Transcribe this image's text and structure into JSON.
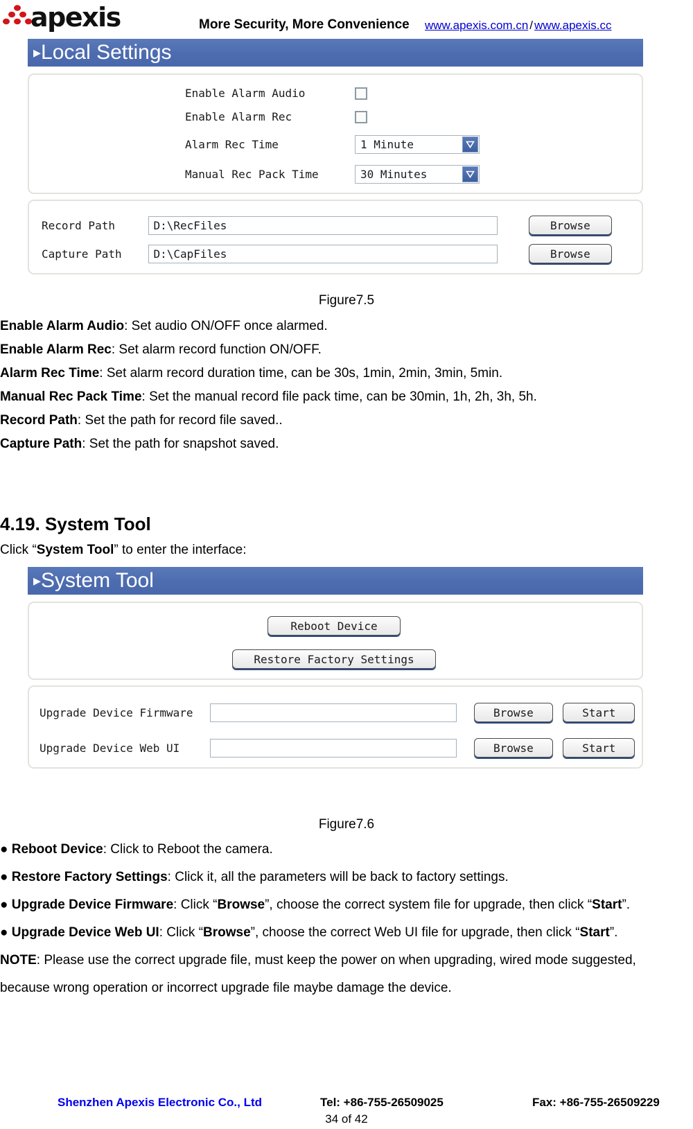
{
  "header": {
    "logo_text": "apexis",
    "tagline": "More Security, More Convenience",
    "link_primary": "www.apexis.com.cn",
    "link_separator": "/",
    "link_secondary": "www.apexis.cc"
  },
  "local_settings": {
    "titlebar": "Local Settings",
    "titlebar_arrow": "▸",
    "fields": {
      "enable_alarm_audio_label": "Enable Alarm Audio",
      "enable_alarm_audio_checked": false,
      "enable_alarm_rec_label": "Enable Alarm Rec",
      "enable_alarm_rec_checked": false,
      "alarm_rec_time_label": "Alarm Rec Time",
      "alarm_rec_time_value": "1 Minute",
      "manual_rec_pack_time_label": "Manual Rec Pack Time",
      "manual_rec_pack_time_value": "30 Minutes",
      "record_path_label": "Record Path",
      "record_path_value": "D:\\RecFiles",
      "capture_path_label": "Capture Path",
      "capture_path_value": "D:\\CapFiles",
      "browse_record_label": "Browse",
      "browse_capture_label": "Browse"
    },
    "caption": "Figure7.5"
  },
  "local_settings_desc": [
    {
      "term": "Enable Alarm Audio",
      "text": ": Set audio ON/OFF once alarmed."
    },
    {
      "term": "Enable Alarm Rec",
      "text": ": Set alarm record function ON/OFF."
    },
    {
      "term": "Alarm Rec Time",
      "text": ": Set alarm record duration time, can be 30s, 1min, 2min, 3min, 5min."
    },
    {
      "term": "Manual Rec Pack Time",
      "text": ": Set the manual record file pack time, can be 30min, 1h, 2h, 3h, 5h."
    },
    {
      "term": "Record Path",
      "text": ": Set the path for record file saved.."
    },
    {
      "term": "Capture Path",
      "text": ": Set the path for snapshot saved."
    }
  ],
  "system_tool": {
    "section_heading": "4.19. System Tool",
    "intro_pre": "Click “",
    "intro_bold": "System Tool",
    "intro_post": "” to enter the interface:",
    "titlebar": "System Tool",
    "titlebar_arrow": "▸",
    "reboot_button": "Reboot Device",
    "restore_button": "Restore Factory Settings",
    "upgrade_firmware_label": "Upgrade Device Firmware",
    "upgrade_firmware_value": "",
    "upgrade_firmware_browse": "Browse",
    "upgrade_firmware_start": "Start",
    "upgrade_webui_label": "Upgrade Device Web UI",
    "upgrade_webui_value": "",
    "upgrade_webui_browse": "Browse",
    "upgrade_webui_start": "Start",
    "caption": "Figure7.6"
  },
  "system_tool_desc": [
    {
      "bullet": "●",
      "term": "Reboot Device",
      "text": ": Click to Reboot the camera."
    },
    {
      "bullet": "●",
      "term": "Restore Factory Settings",
      "text": ": Click it, all the parameters will be back to factory settings."
    }
  ],
  "system_tool_desc_firmware": {
    "bullet": "●",
    "term": "Upgrade Device Firmware",
    "p1": ": Click “",
    "b1": "Browse",
    "p2": "”, choose the correct system file for upgrade, then click “",
    "b2": "Start",
    "p3": "”."
  },
  "system_tool_desc_webui": {
    "bullet": "●",
    "term": "Upgrade Device Web UI",
    "p1": ": Click “",
    "b1": "Browse",
    "p2": "”, choose the correct Web UI file for upgrade, then click “",
    "b2": "Start",
    "p3": "”."
  },
  "note": {
    "term": "NOTE",
    "line1": ": Please use the correct upgrade file, must keep the power on when upgrading, wired mode suggested,",
    "line2": "because wrong operation or incorrect upgrade file maybe damage the device."
  },
  "footer": {
    "company": "Shenzhen Apexis Electronic Co., Ltd",
    "tel": "Tel: +86-755-26509025",
    "fax": "Fax: +86-755-26509229",
    "page": "34 of 42"
  },
  "colors": {
    "titlebar_blue": "#4d6cb0",
    "link_blue": "#0000cc",
    "footer_company_blue": "#0000ee",
    "logo_red": "#d1161a",
    "panel_border": "#e4e2dd"
  }
}
